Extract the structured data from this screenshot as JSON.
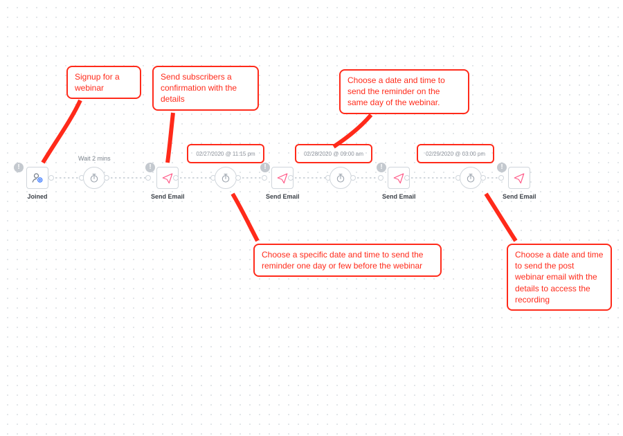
{
  "callouts": {
    "signup": "Signup for a webinar",
    "confirm": "Send subscribers a confirmation with the details",
    "sameday": "Choose a date and time to send the reminder on the same day of the webinar.",
    "before": "Choose a specific date and time to send the reminder one day or few before the webinar",
    "post": "Choose a date and time to send the post webinar email with the details to access the recording"
  },
  "nodes": {
    "joined": "Joined",
    "send1": "Send Email",
    "send2": "Send Email",
    "send3": "Send Email",
    "send4": "Send Email"
  },
  "wait_labels": {
    "wait1": "Wait  2 mins",
    "wait2": "02/27/2020 @ 11:15 pm",
    "wait3": "02/28/2020 @ 09:00 am",
    "wait4": "02/29/2020 @ 03:00 pm"
  },
  "warn_glyph": "!",
  "colors": {
    "red": "#ff2a1a",
    "node_border": "#cfd5db",
    "text_muted": "#7a828b"
  }
}
